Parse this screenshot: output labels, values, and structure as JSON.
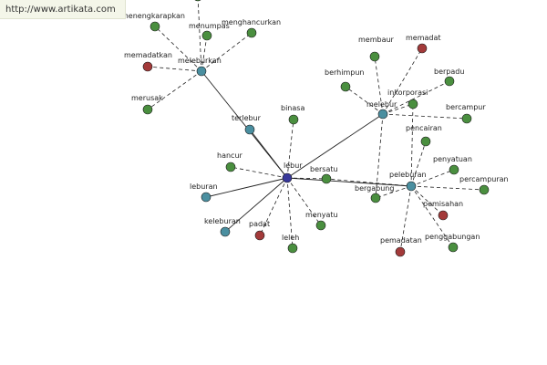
{
  "watermark": "http://www.artikata.com",
  "colors": {
    "blue": "#38389a",
    "teal": "#4a8fa0",
    "green": "#4a8f3f",
    "red": "#a33a3a",
    "edge": "#222222"
  },
  "nodes": [
    {
      "id": "lebur",
      "label": "lebur",
      "color": "blue"
    },
    {
      "id": "melebur",
      "label": "melebur",
      "color": "teal"
    },
    {
      "id": "meleburkan",
      "label": "meleburkan",
      "color": "teal"
    },
    {
      "id": "terlebur",
      "label": "terlebur",
      "color": "teal"
    },
    {
      "id": "peleburan",
      "label": "peleburan",
      "color": "teal"
    },
    {
      "id": "leburan",
      "label": "leburan",
      "color": "teal"
    },
    {
      "id": "keleburan",
      "label": "keleburan",
      "color": "teal"
    },
    {
      "id": "menengkarapkan",
      "label": "menengkarapkan",
      "color": "green"
    },
    {
      "id": "menumpas",
      "label": "menumpas",
      "color": "green"
    },
    {
      "id": "menghancurkan",
      "label": "menghancurkan",
      "color": "green"
    },
    {
      "id": "memadatkan",
      "label": "memadatkan",
      "color": "red"
    },
    {
      "id": "merusak",
      "label": "merusak",
      "color": "green"
    },
    {
      "id": "membaur",
      "label": "membaur",
      "color": "green"
    },
    {
      "id": "memadat",
      "label": "memadat",
      "color": "red"
    },
    {
      "id": "berhimpun",
      "label": "berhimpun",
      "color": "green"
    },
    {
      "id": "berpadu",
      "label": "berpadu",
      "color": "green"
    },
    {
      "id": "inkorporasi",
      "label": "inkorporasi",
      "color": "green"
    },
    {
      "id": "bercampur",
      "label": "bercampur",
      "color": "green"
    },
    {
      "id": "binasa",
      "label": "binasa",
      "color": "green"
    },
    {
      "id": "pencairan",
      "label": "pencairan",
      "color": "green"
    },
    {
      "id": "hancur",
      "label": "hancur",
      "color": "green"
    },
    {
      "id": "bersatu",
      "label": "bersatu",
      "color": "green"
    },
    {
      "id": "penyatuan",
      "label": "penyatuan",
      "color": "green"
    },
    {
      "id": "percampuran",
      "label": "percampuran",
      "color": "green"
    },
    {
      "id": "bergabung",
      "label": "bergabung",
      "color": "green"
    },
    {
      "id": "pemisahan",
      "label": "pemisahan",
      "color": "red"
    },
    {
      "id": "padat",
      "label": "padat",
      "color": "red"
    },
    {
      "id": "menyatu",
      "label": "menyatu",
      "color": "green"
    },
    {
      "id": "leleh",
      "label": "leleh",
      "color": "green"
    },
    {
      "id": "pemadatan",
      "label": "pemadatan",
      "color": "red"
    },
    {
      "id": "penggabungan",
      "label": "penggabungan",
      "color": "green"
    },
    {
      "id": "top_partial",
      "label": "",
      "color": "green"
    }
  ],
  "edges": [
    {
      "from": "lebur",
      "to": "meleburkan",
      "style": "solid"
    },
    {
      "from": "lebur",
      "to": "melebur",
      "style": "solid"
    },
    {
      "from": "lebur",
      "to": "leburan",
      "style": "solid"
    },
    {
      "from": "lebur",
      "to": "peleburan",
      "style": "solid"
    },
    {
      "from": "lebur",
      "to": "terlebur",
      "style": "solid"
    },
    {
      "from": "lebur",
      "to": "keleburan",
      "style": "solid"
    },
    {
      "from": "lebur",
      "to": "binasa",
      "style": "dashed"
    },
    {
      "from": "lebur",
      "to": "hancur",
      "style": "dashed"
    },
    {
      "from": "lebur",
      "to": "bersatu",
      "style": "dashed"
    },
    {
      "from": "lebur",
      "to": "menyatu",
      "style": "dashed"
    },
    {
      "from": "lebur",
      "to": "leleh",
      "style": "dashed"
    },
    {
      "from": "lebur",
      "to": "padat",
      "style": "dashed"
    },
    {
      "from": "meleburkan",
      "to": "menengkarapkan",
      "style": "dashed"
    },
    {
      "from": "meleburkan",
      "to": "menumpas",
      "style": "dashed"
    },
    {
      "from": "meleburkan",
      "to": "menghancurkan",
      "style": "dashed"
    },
    {
      "from": "meleburkan",
      "to": "memadatkan",
      "style": "dashed"
    },
    {
      "from": "meleburkan",
      "to": "merusak",
      "style": "dashed"
    },
    {
      "from": "meleburkan",
      "to": "top_partial",
      "style": "dashed"
    },
    {
      "from": "melebur",
      "to": "membaur",
      "style": "dashed"
    },
    {
      "from": "melebur",
      "to": "memadat",
      "style": "dashed"
    },
    {
      "from": "melebur",
      "to": "berhimpun",
      "style": "dashed"
    },
    {
      "from": "melebur",
      "to": "berpadu",
      "style": "dashed"
    },
    {
      "from": "melebur",
      "to": "inkorporasi",
      "style": "dashed"
    },
    {
      "from": "melebur",
      "to": "bercampur",
      "style": "dashed"
    },
    {
      "from": "melebur",
      "to": "bergabung",
      "style": "dashed"
    },
    {
      "from": "peleburan",
      "to": "pencairan",
      "style": "dashed"
    },
    {
      "from": "peleburan",
      "to": "penyatuan",
      "style": "dashed"
    },
    {
      "from": "peleburan",
      "to": "percampuran",
      "style": "dashed"
    },
    {
      "from": "peleburan",
      "to": "pemisahan",
      "style": "dashed"
    },
    {
      "from": "peleburan",
      "to": "pemadatan",
      "style": "dashed"
    },
    {
      "from": "peleburan",
      "to": "penggabungan",
      "style": "dashed"
    },
    {
      "from": "peleburan",
      "to": "inkorporasi",
      "style": "dashed"
    },
    {
      "from": "peleburan",
      "to": "bersatu",
      "style": "dashed"
    },
    {
      "from": "peleburan",
      "to": "bergabung",
      "style": "dashed"
    }
  ]
}
